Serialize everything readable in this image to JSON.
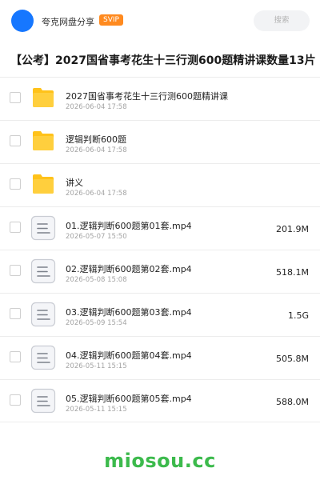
{
  "header": {
    "username": "夸克网盘分享",
    "badge": "SVIP",
    "search_placeholder": "搜索"
  },
  "share": {
    "title": "【公考】2027国省事考花生十三行测600题精讲课数量13片"
  },
  "files": [
    {
      "name": "2027国省事考花生十三行测600题精讲课",
      "date": "2026-06-04 17:58",
      "size": "",
      "icon": "folder-icon"
    },
    {
      "name": "逻辑判断600题",
      "date": "2026-06-04 17:58",
      "size": "",
      "icon": "folder-icon"
    },
    {
      "name": "讲义",
      "date": "2026-06-04 17:58",
      "size": "",
      "icon": "folder-icon"
    },
    {
      "name": "01.逻辑判断600题第01套.mp4",
      "date": "2026-05-07 15:50",
      "size": "201.9M",
      "icon": "file-icon"
    },
    {
      "name": "02.逻辑判断600题第02套.mp4",
      "date": "2026-05-08 15:08",
      "size": "518.1M",
      "icon": "file-icon"
    },
    {
      "name": "03.逻辑判断600题第03套.mp4",
      "date": "2026-05-09 15:54",
      "size": "1.5G",
      "icon": "file-icon"
    },
    {
      "name": "04.逻辑判断600题第04套.mp4",
      "date": "2026-05-11 15:15",
      "size": "505.8M",
      "icon": "file-icon"
    },
    {
      "name": "05.逻辑判断600题第05套.mp4",
      "date": "2026-05-11 15:15",
      "size": "588.0M",
      "icon": "file-icon"
    }
  ],
  "watermark": "miosou.cc",
  "colors": {
    "accent": "#1677ff",
    "badge": "#ff8a1f",
    "folder": "#ffc21a",
    "watermark": "#3cba4c"
  }
}
